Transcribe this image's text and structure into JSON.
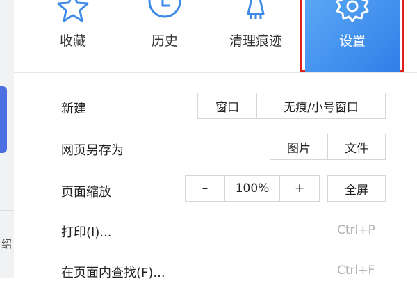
{
  "top_items": [
    {
      "label": "收藏",
      "icon": "star-icon"
    },
    {
      "label": "历史",
      "icon": "clock-icon"
    },
    {
      "label": "清理痕迹",
      "icon": "broom-icon"
    },
    {
      "label": "设置",
      "icon": "gear-icon"
    }
  ],
  "menu": {
    "new_label": "新建",
    "new_window": "窗口",
    "new_incognito": "无痕/小号窗口",
    "save_as_label": "网页另存为",
    "save_image": "图片",
    "save_file": "文件",
    "zoom_label": "页面缩放",
    "zoom_minus": "–",
    "zoom_value": "100%",
    "zoom_plus": "+",
    "fullscreen": "全屏",
    "print_label": "打印(I)...",
    "print_shortcut": "Ctrl+P",
    "find_label": "在页面内查找(F)...",
    "find_shortcut": "Ctrl+F"
  },
  "page_fragment": "绍",
  "colors": {
    "settings_blue": "#3a8cf0",
    "highlight_red": "#e02020"
  }
}
